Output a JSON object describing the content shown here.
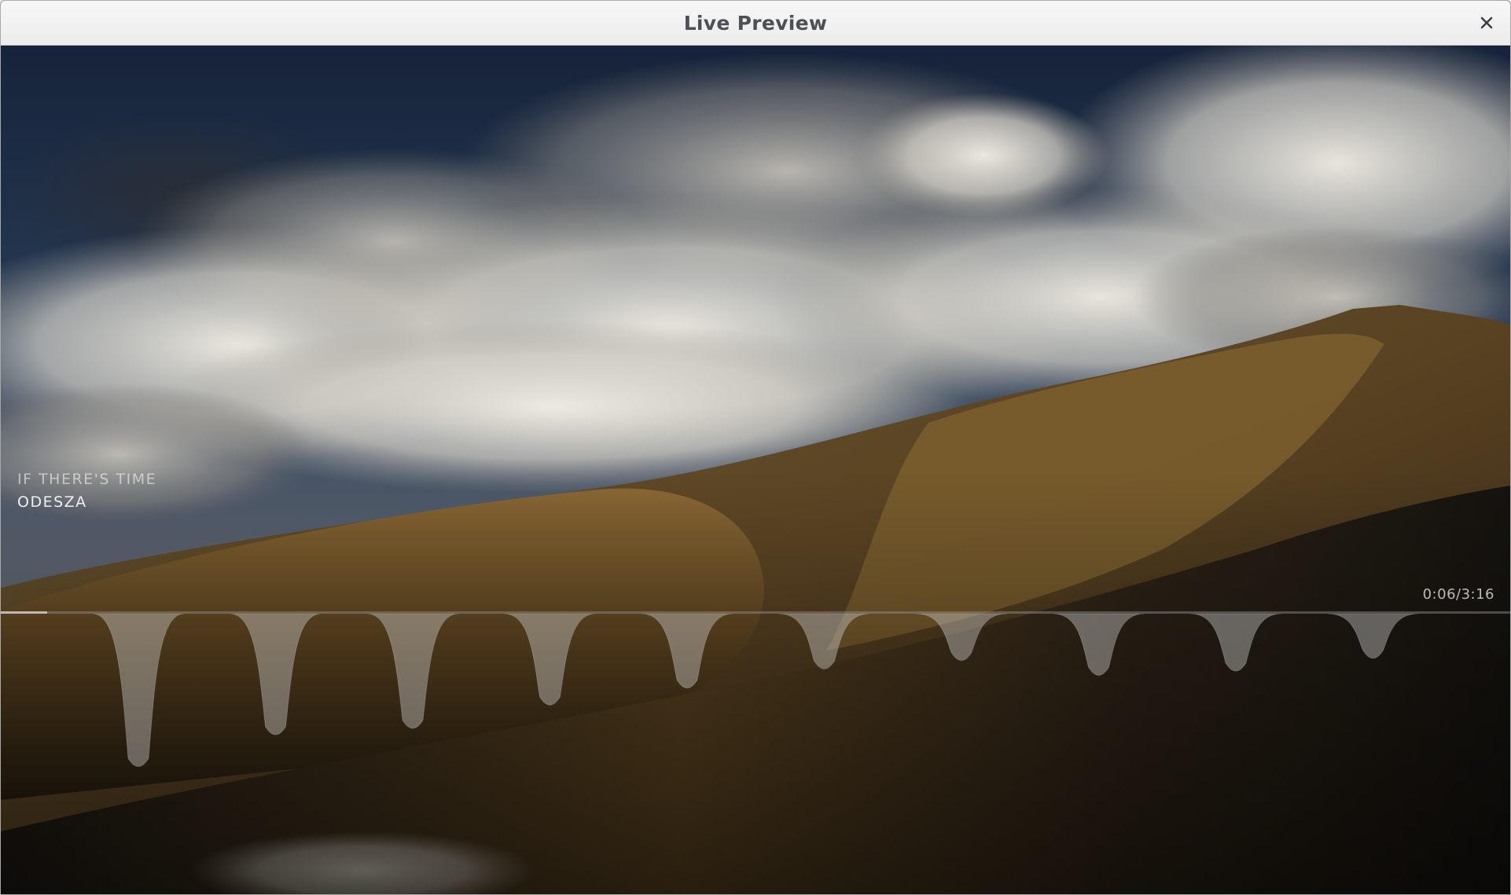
{
  "window": {
    "title": "Live Preview",
    "close_icon": "close-icon"
  },
  "player": {
    "track_title": "IF THERE'S TIME",
    "artist": "ODESZA",
    "time": "0:06/3:16",
    "progress": 0.0306
  },
  "visualizer": {
    "style": "drip-wave",
    "bar_color": "#cfcfcf",
    "bar_levels": [
      0.73,
      0.58,
      0.55,
      0.44,
      0.36,
      0.27,
      0.23,
      0.3,
      0.28,
      0.22
    ]
  },
  "colors": {
    "titlebar": "#efefef",
    "title_text": "#4c5157",
    "sky": "#1d2a3d",
    "hills": "#7a5a2c"
  }
}
